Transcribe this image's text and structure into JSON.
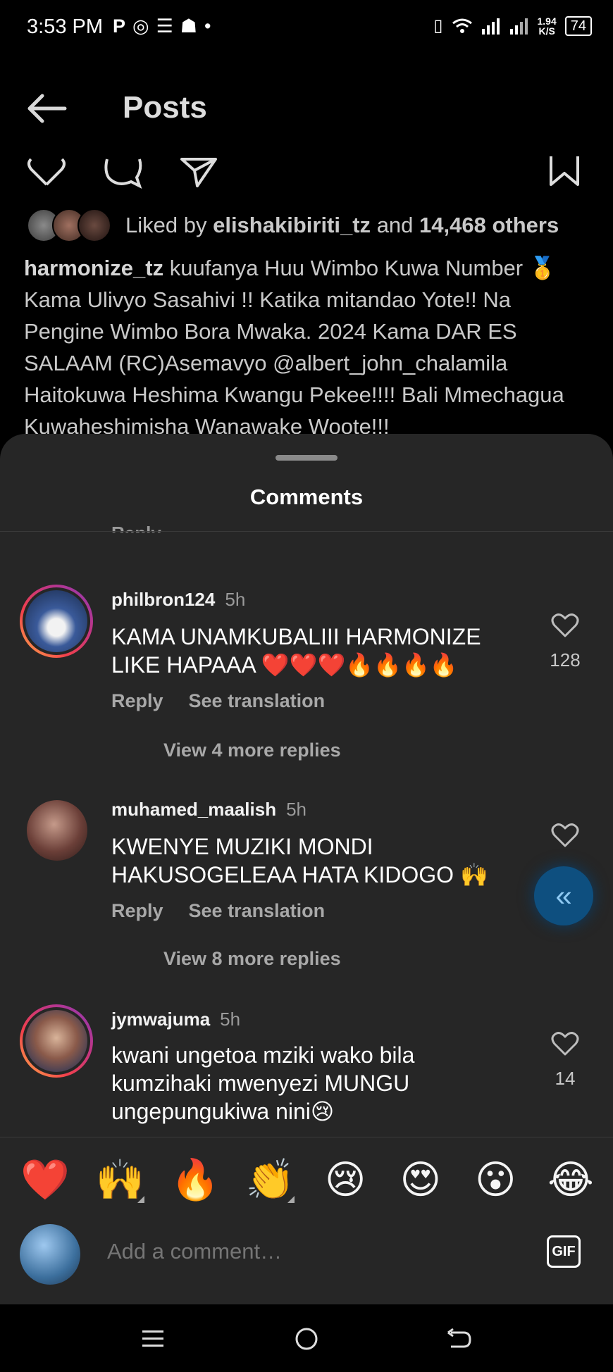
{
  "status_bar": {
    "time": "3:53 PM",
    "left_icons": [
      "p-icon",
      "whatsapp-icon",
      "news-icon",
      "snapchat-icon",
      "dot-icon"
    ],
    "net_speed_value": "1.94",
    "net_speed_unit": "K/S",
    "battery": "74"
  },
  "header": {
    "title": "Posts"
  },
  "post": {
    "liked_by_prefix": "Liked by",
    "liked_by_user": "elishakibiriti_tz",
    "liked_by_and": "and",
    "liked_by_count": "14,468 others",
    "caption_user": "harmonize_tz",
    "caption_text": "kuufanya Huu Wimbo Kuwa Number 🥇 Kama  Ulivyo Sasahivi !! Katika mitandao Yote!! Na Pengine Wimbo Bora Mwaka. 2024 Kama DAR ES SALAAM (RC)Asemavyo  @albert_john_chalamila Haitokuwa Heshima Kwangu Pekee!!!! Bali Mmechagua Kuwaheshimisha Wanawake Woote!!!"
  },
  "comments_sheet": {
    "title": "Comments",
    "cut_off_reply": "Reply",
    "comments": [
      {
        "username": "philbron124",
        "time": "5h",
        "text": "KAMA UNAMKUBALIII HARMONIZE LIKE HAPAAA ❤️❤️❤️🔥🔥🔥🔥",
        "reply": "Reply",
        "translate": "See translation",
        "likes": "128",
        "view_more": "View 4 more replies"
      },
      {
        "username": "muhamed_maalish",
        "time": "5h",
        "text": "KWENYE MUZIKI MONDI HAKUSOGELEAA HATA KIDOGO 🙌",
        "reply": "Reply",
        "translate": "See translation",
        "likes": "",
        "view_more": "View 8 more replies"
      },
      {
        "username": "jymwajuma",
        "time": "5h",
        "text": "kwani ungetoa mziki wako bila kumzihaki mwenyezi MUNGU ungepungukiwa nini😢",
        "likes": "14"
      }
    ]
  },
  "reactions": [
    "❤️",
    "🙌",
    "🔥",
    "👏",
    "😢",
    "😍",
    "😮",
    "😂"
  ],
  "composer": {
    "placeholder": "Add a comment…",
    "gif_label": "GIF"
  },
  "colors": {
    "background": "#000000",
    "sheet": "#262626",
    "float_button": "#0e4f7f"
  }
}
